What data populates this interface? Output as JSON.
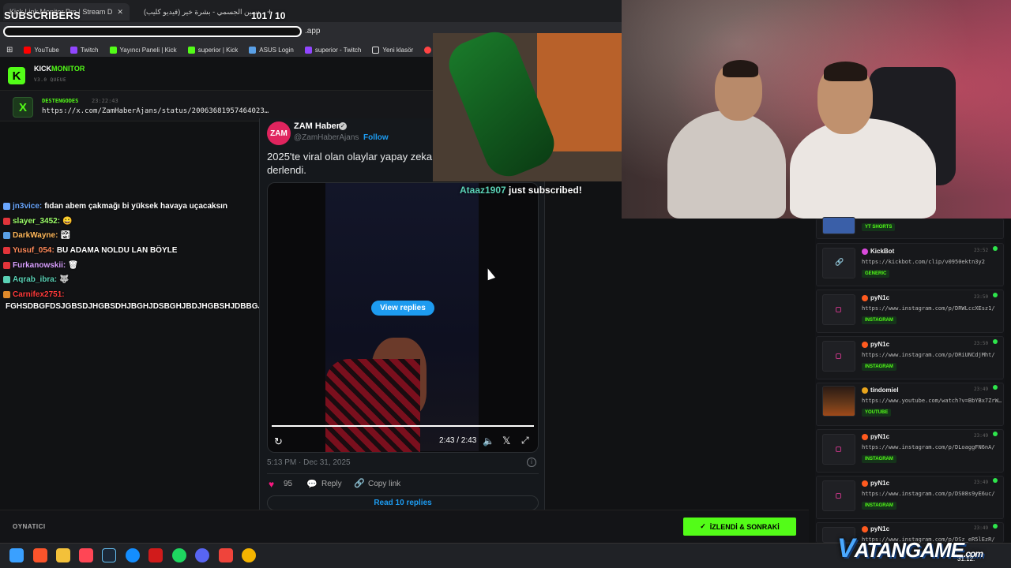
{
  "browser": {
    "tabs": [
      {
        "title": "Kick Link Monitor Pro | Stream D",
        "close": "✕"
      },
      {
        "title": "حسين الجسمي - بشرة خير (فيديو كليب)"
      }
    ],
    "new_tab": "+",
    "url_tail": ".app",
    "bookmarks": [
      {
        "label": "YouTube",
        "color": "#ff0000"
      },
      {
        "label": "Twitch",
        "color": "#9146ff"
      },
      {
        "label": "Yayıncı Paneli | Kick",
        "color": "#53fc18"
      },
      {
        "label": "superior | Kick",
        "color": "#53fc18"
      },
      {
        "label": "ASUS Login",
        "color": "#5aa0e6"
      },
      {
        "label": "superior - Twitch",
        "color": "#9146ff"
      },
      {
        "label": "Yeni klasör",
        "color": "#dddddd"
      },
      {
        "label": "B",
        "color": "#ff4444"
      }
    ]
  },
  "overlay": {
    "subs_label": "SUBSCRIBERS",
    "subs_count": "101 / 10",
    "alert_name": "Ataaz1907",
    "alert_text": " just subscribed!"
  },
  "app": {
    "logo": "K",
    "name_a": "KICK",
    "name_b": "MONITOR",
    "version": "V3.0 QUEUE",
    "now": {
      "icon": "X",
      "user": "DESTENGODES",
      "time": "23:22:43",
      "url": "https://x.com/ZamHaberAjans/status/20063681957464023…"
    },
    "footer_label": "OYNATICI",
    "next_button": "İZLENDİ & SONRAKİ"
  },
  "chat": [
    {
      "user": "jn3vice:",
      "msg": "fıdan abem çakmağı bi yüksek havaya uçacaksın",
      "color": "#6aa7ff",
      "badge": "#6aa7ff"
    },
    {
      "user": "slayer_3452:",
      "msg": "😀",
      "color": "#9dff6a",
      "badge": "#e2343a"
    },
    {
      "user": "DarkWayne:",
      "msg": "🏞",
      "color": "#ffb85a",
      "badge": "#5aa0e6"
    },
    {
      "user": "Yusuf_054:",
      "msg": "BU ADAMA NOLDU LAN BÖYLE",
      "color": "#ff8a5a",
      "badge": "#e2343a"
    },
    {
      "user": "Furkanowskii:",
      "msg": "🗑",
      "color": "#d9a0ff",
      "badge": "#e2343a"
    },
    {
      "user": "Aqrab_ibra:",
      "msg": "🐺",
      "color": "#5ad1b5",
      "badge": "#5ad1b5"
    },
    {
      "user": "Carnifex2751:",
      "msg": "",
      "color": "#ff3a3a",
      "badge": "#e08a2a"
    },
    {
      "user": "",
      "msg": "FGHSDBGFDSJGBSDJHGBSDHJBGHJDSBGHJBDJHGBSHJDBBGJDS",
      "color": "#ffffff",
      "badge": ""
    }
  ],
  "tweet": {
    "avatar": "ZAM",
    "name": "ZAM Haber",
    "handle": "@ZamHaberAjans",
    "follow": "Follow",
    "text": "2025'te viral olan olaylar yapay zeka derlendi.",
    "view_replies": "View replies",
    "video_time": "2:43 / 2:43",
    "date": "5:13 PM · Dec 31, 2025",
    "likes": "95",
    "reply": "Reply",
    "copy_link": "Copy link",
    "read_replies": "Read 10 replies"
  },
  "clips": [
    {
      "user": "",
      "time": "",
      "url": "",
      "tag": "YT SHORTS",
      "avatar": "#e2343a"
    },
    {
      "user": "KickBot",
      "time": "23:52",
      "url": "https://kickbot.com/clip/v0950ektn3y2",
      "tag": "GENERIC",
      "avatar": "#d94adb"
    },
    {
      "user": "pyN1c",
      "time": "23:50",
      "url": "https://www.instagram.com/p/DRWLccXEsz1/",
      "tag": "INSTAGRAM",
      "avatar": "#ff5a1f"
    },
    {
      "user": "pyN1c",
      "time": "23:50",
      "url": "https://www.instagram.com/p/DRiUNCdjMht/",
      "tag": "INSTAGRAM",
      "avatar": "#ff5a1f"
    },
    {
      "user": "tindomiel",
      "time": "23:49",
      "url": "https://www.youtube.com/watch?v=BbYBx7ZrW…",
      "tag": "YOUTUBE",
      "avatar": "#e8a41c"
    },
    {
      "user": "pyN1c",
      "time": "23:49",
      "url": "https://www.instagram.com/p/DLoaggFN6nA/",
      "tag": "INSTAGRAM",
      "avatar": "#ff5a1f"
    },
    {
      "user": "pyN1c",
      "time": "23:49",
      "url": "https://www.instagram.com/p/DS08s9yE6uc/",
      "tag": "INSTAGRAM",
      "avatar": "#ff5a1f"
    },
    {
      "user": "pyN1c",
      "time": "23:49",
      "url": "https://www.instagram.com/p/DSz_eR5lEzR/",
      "tag": "INSTAGRAM",
      "avatar": "#ff5a1f"
    }
  ],
  "taskbar": {
    "watermark_v": "V",
    "watermark_text": "ATANGAME",
    "watermark_tld": ".com",
    "clock": "31.12.",
    "icons": [
      {
        "name": "windows-start-icon",
        "color": "#3aa0ff"
      },
      {
        "name": "brave-browser-icon",
        "color": "#fb542b"
      },
      {
        "name": "file-explorer-icon",
        "color": "#f3c13a"
      },
      {
        "name": "valorant-icon",
        "color": "#ff4655"
      },
      {
        "name": "steam-icon",
        "color": "#1b2838"
      },
      {
        "name": "battle-net-icon",
        "color": "#148eff"
      },
      {
        "name": "msi-icon",
        "color": "#d11b1b"
      },
      {
        "name": "spotify-icon",
        "color": "#1ed760"
      },
      {
        "name": "discord-icon",
        "color": "#5865f2"
      },
      {
        "name": "anydesk-icon",
        "color": "#ef443b"
      },
      {
        "name": "chrome-icon",
        "color": "#f4b400"
      }
    ]
  }
}
